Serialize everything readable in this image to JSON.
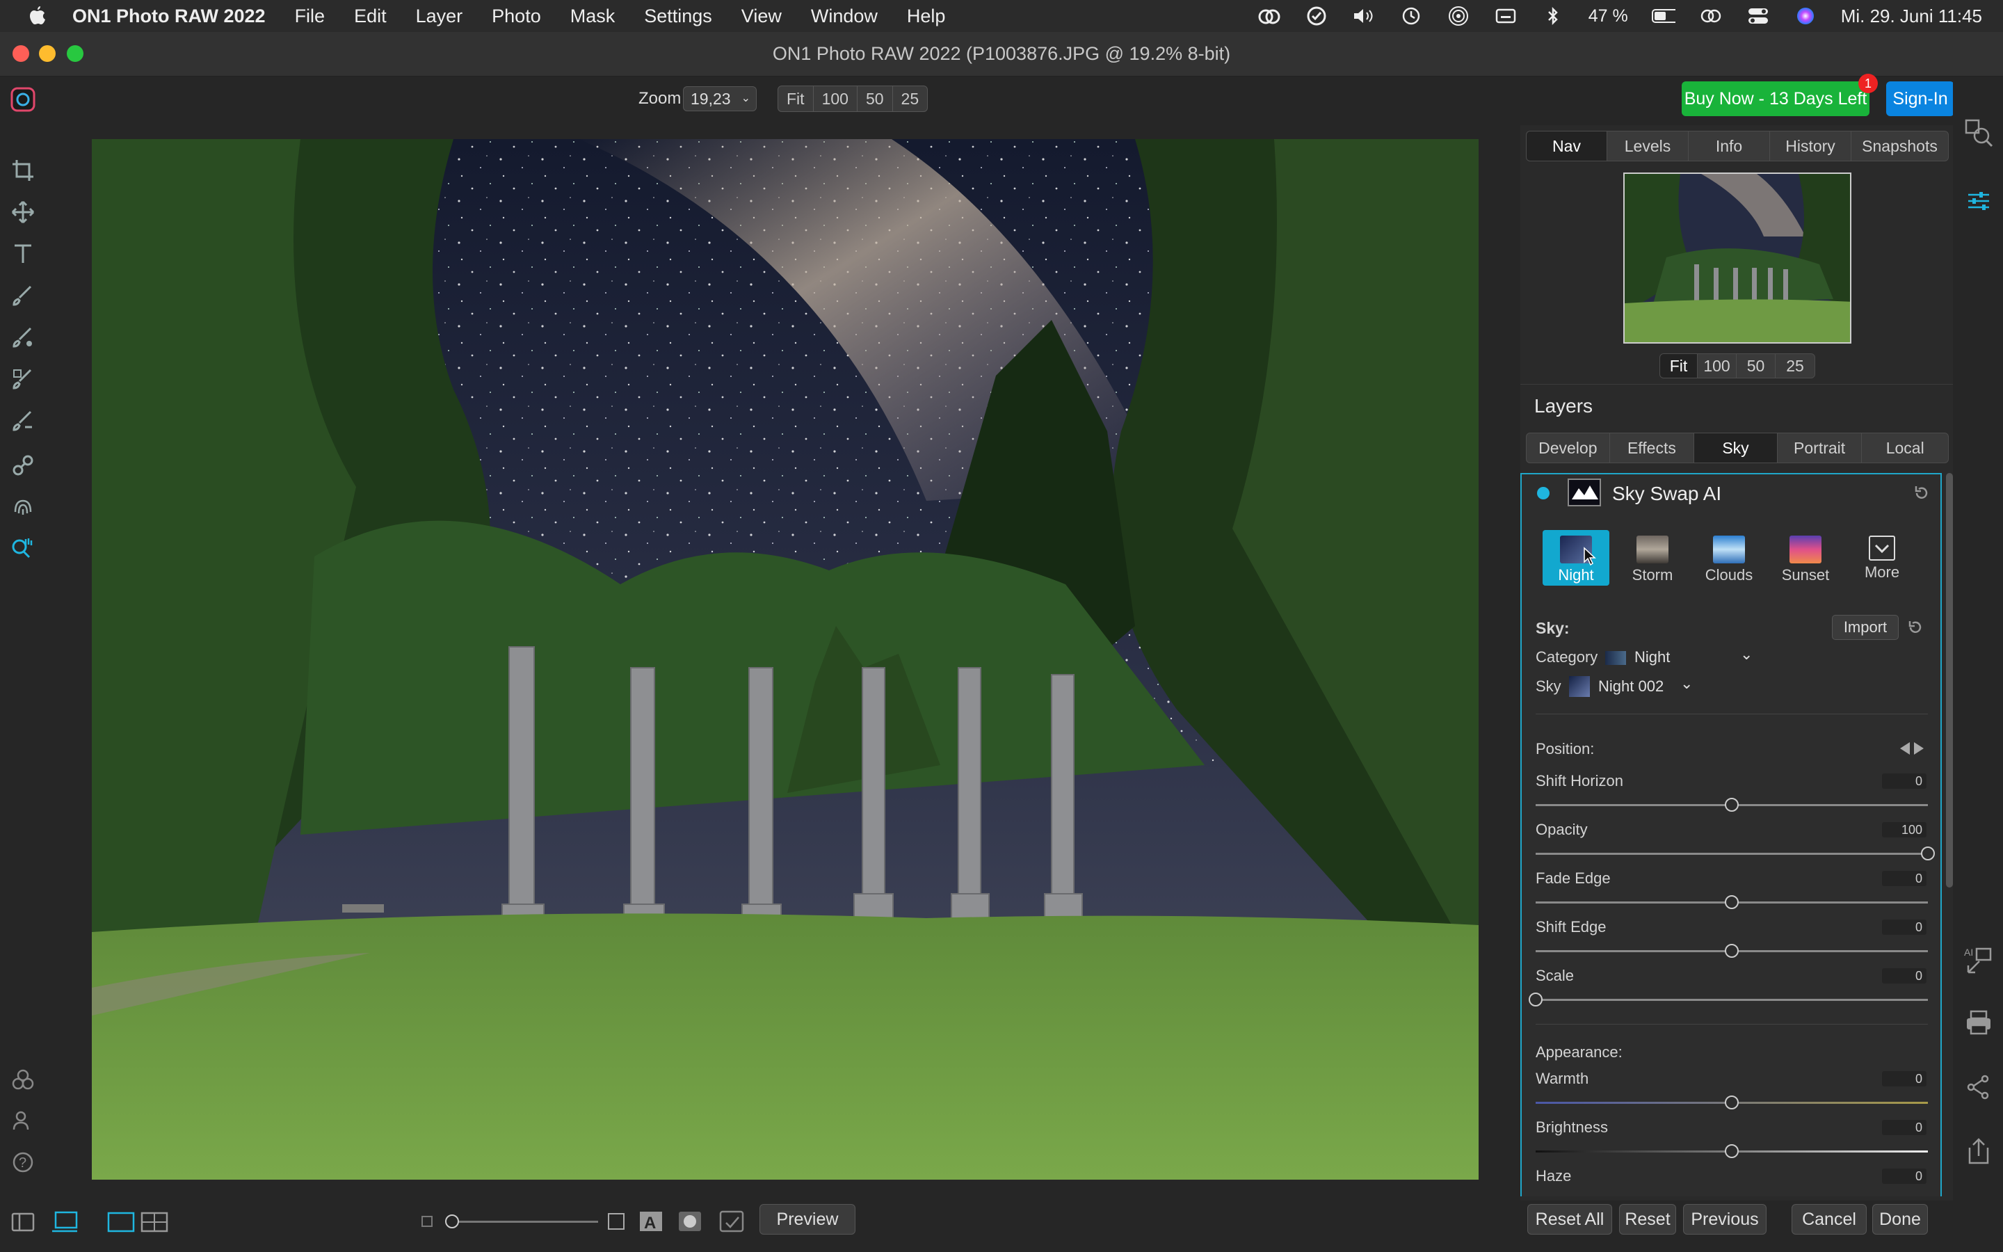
{
  "menubar": {
    "app_name": "ON1 Photo RAW 2022",
    "items": [
      "File",
      "Edit",
      "Layer",
      "Photo",
      "Mask",
      "Settings",
      "View",
      "Window",
      "Help"
    ],
    "battery": "47 %",
    "datetime": "Mi. 29. Juni  11:45"
  },
  "window": {
    "title": "ON1 Photo RAW 2022 (P1003876.JPG @ 19.2% 8-bit)"
  },
  "toolbar": {
    "zoom_label": "Zoom",
    "zoom_value": "19,23",
    "zoom_presets": [
      "Fit",
      "100",
      "50",
      "25"
    ],
    "buy_label": "Buy Now - 13 Days Left",
    "buy_badge": "1",
    "signin_label": "Sign-In"
  },
  "nav_panel": {
    "tabs": [
      "Nav",
      "Levels",
      "Info",
      "History",
      "Snapshots"
    ],
    "active_tab": "Nav",
    "zoom_presets": [
      "Fit",
      "100",
      "50",
      "25"
    ]
  },
  "layers": {
    "title": "Layers",
    "tabs": [
      "Develop",
      "Effects",
      "Sky",
      "Portrait",
      "Local"
    ],
    "active_tab": "Sky"
  },
  "sky_swap": {
    "title": "Sky Swap AI",
    "presets": [
      "Night",
      "Storm",
      "Clouds",
      "Sunset",
      "More"
    ],
    "active_preset": "Night",
    "sky_label": "Sky:",
    "import_label": "Import",
    "category_label": "Category",
    "category_value": "Night",
    "sky_row_label": "Sky",
    "sky_value": "Night 002",
    "position_label": "Position:",
    "sliders": [
      {
        "label": "Shift Horizon",
        "value": "0",
        "level": 0.5
      },
      {
        "label": "Opacity",
        "value": "100",
        "level": 1.0
      },
      {
        "label": "Fade Edge",
        "value": "0",
        "level": 0.5
      },
      {
        "label": "Shift Edge",
        "value": "0",
        "level": 0.5
      },
      {
        "label": "Scale",
        "value": "0",
        "level": 0.0
      }
    ],
    "appearance_label": "Appearance:",
    "appearance_sliders": [
      {
        "label": "Warmth",
        "value": "0",
        "level": 0.5
      },
      {
        "label": "Brightness",
        "value": "0",
        "level": 0.5
      },
      {
        "label": "Haze",
        "value": "0",
        "level": 0.5
      }
    ]
  },
  "bottom": {
    "preview_label": "Preview",
    "reset_all": "Reset All",
    "reset": "Reset",
    "previous": "Previous",
    "cancel": "Cancel",
    "done": "Done"
  },
  "colors": {
    "accent": "#1fa7c9",
    "buy_green": "#19b33a",
    "signin_blue": "#0a84e0"
  }
}
